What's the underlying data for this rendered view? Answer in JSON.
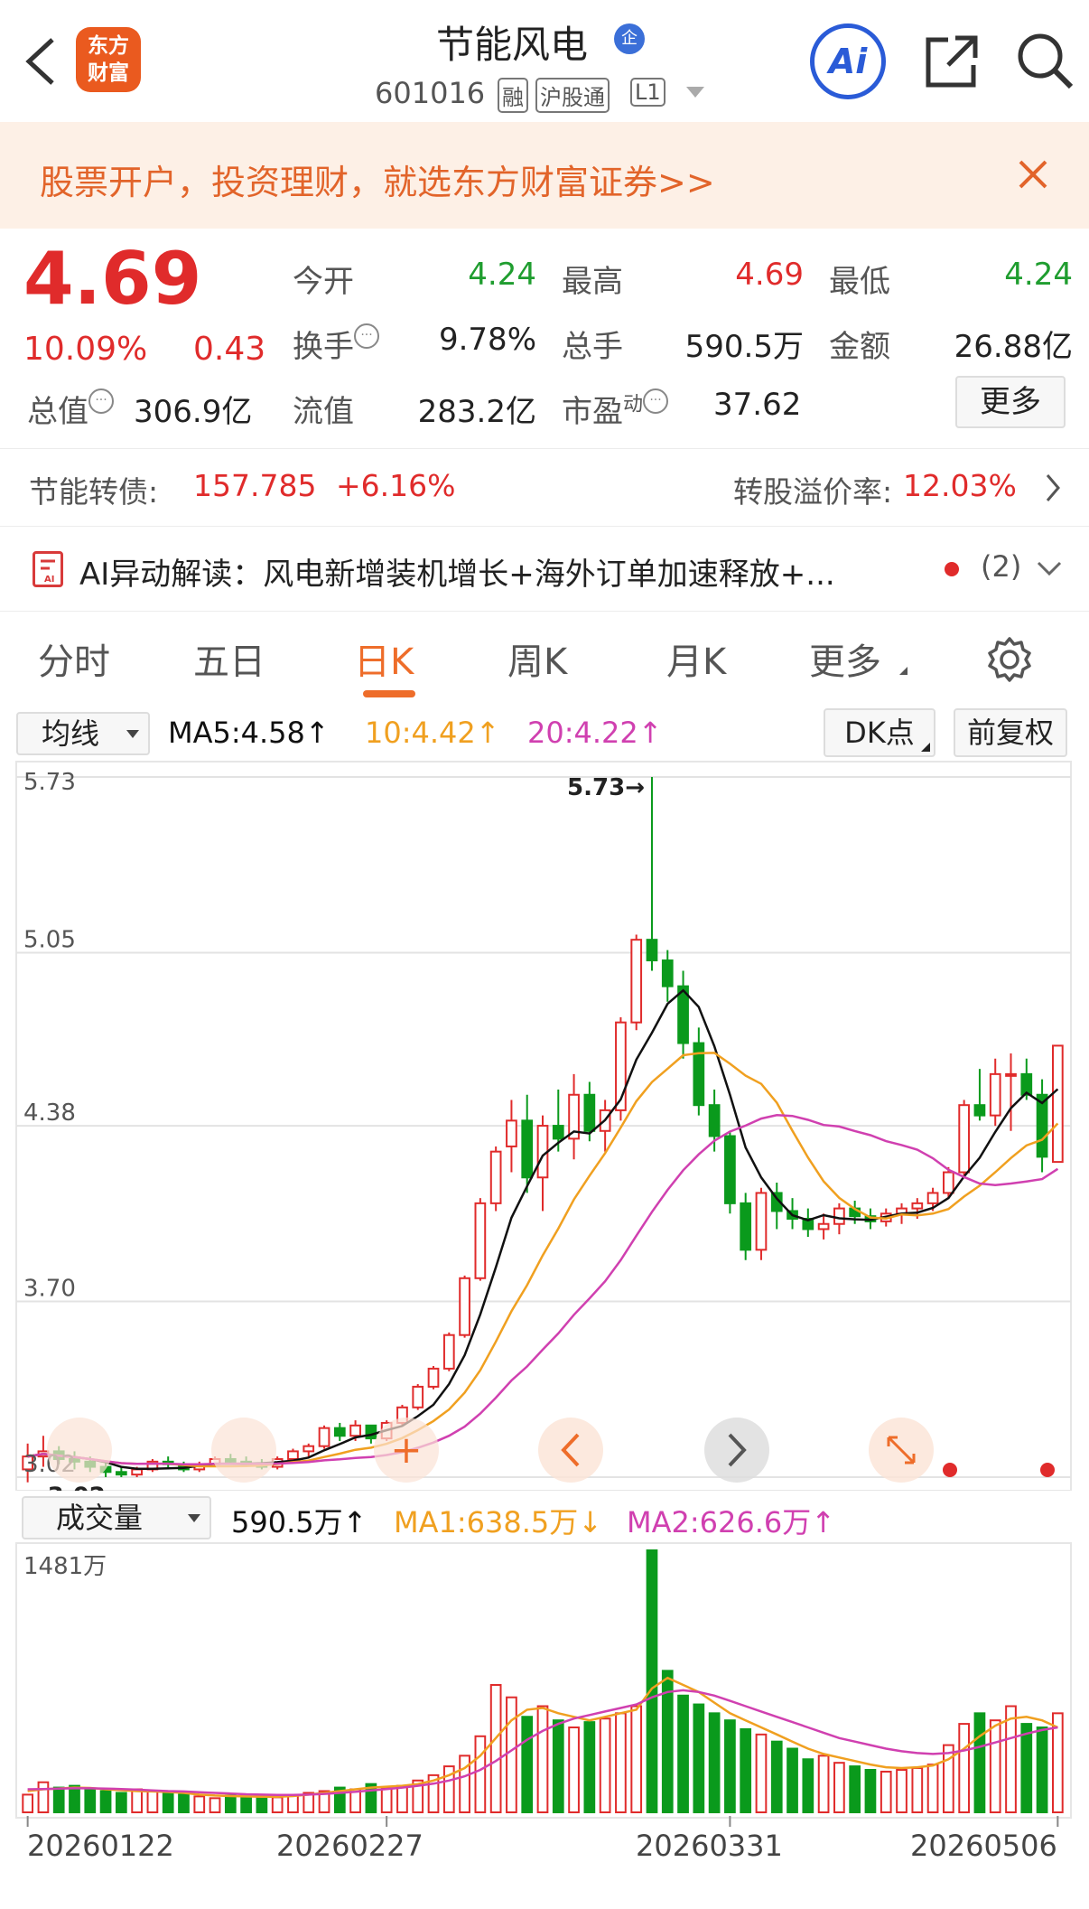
{
  "header": {
    "logo_text": "东方财富",
    "stock_name": "节能风电",
    "badge": "企",
    "code": "601016",
    "tags": [
      "融",
      "沪股通",
      "L1"
    ],
    "ai_label": "Ai"
  },
  "banner": {
    "text": "股票开户，投资理财，就选东方财富证券>>"
  },
  "quote": {
    "price": "4.69",
    "change_pct": "10.09%",
    "change": "0.43",
    "open_label": "今开",
    "open": "4.24",
    "high_label": "最高",
    "high": "4.69",
    "low_label": "最低",
    "low": "4.24",
    "turnover_label": "换手",
    "turnover": "9.78%",
    "volume_label": "总手",
    "volume": "590.5万",
    "amount_label": "金额",
    "amount": "26.88亿",
    "mktcap_label": "总值",
    "mktcap": "306.9亿",
    "float_label": "流值",
    "float_cap": "283.2亿",
    "pe_label": "市盈",
    "pe_sup": "动",
    "pe": "37.62",
    "more_button": "更多"
  },
  "bond": {
    "label": "节能转债:",
    "price": "157.785",
    "change": "+6.16%",
    "premium_label": "转股溢价率:",
    "premium": "12.03%"
  },
  "ai_insight": {
    "text": "AI异动解读：风电新增装机增长+海外订单加速释放+...",
    "count": "(2)"
  },
  "tabs": [
    "分时",
    "五日",
    "日K",
    "周K",
    "月K",
    "更多"
  ],
  "active_tab": "日K",
  "kline_controls": {
    "indicator": "均线",
    "ma5": "MA5:4.58↑",
    "ma10": "10:4.42↑",
    "ma20": "20:4.22↑",
    "dk_button": "DK点",
    "adjust_button": "前复权"
  },
  "volume_controls": {
    "indicator": "成交量",
    "vol": "590.5万↑",
    "ma1": "MA1:638.5万↓",
    "ma2": "MA2:626.6万↑"
  },
  "colors": {
    "up": "#e02b2b",
    "down": "#0a9a1c",
    "ma5": "#111111",
    "ma10": "#f0a020",
    "ma20": "#d040b0",
    "accent": "#ee6d2a"
  },
  "chart_data": [
    {
      "type": "candlestick",
      "y_ticks": [
        "5.73",
        "5.05",
        "4.38",
        "3.70",
        "3.02"
      ],
      "ylim": [
        3.02,
        5.73
      ],
      "max_label": "5.73→",
      "min_label": "3.02",
      "ohlc": [
        [
          3.05,
          3.15,
          3.0,
          3.1
        ],
        [
          3.1,
          3.18,
          3.06,
          3.12
        ],
        [
          3.12,
          3.14,
          3.07,
          3.09
        ],
        [
          3.09,
          3.12,
          3.05,
          3.08
        ],
        [
          3.08,
          3.1,
          3.04,
          3.06
        ],
        [
          3.06,
          3.08,
          3.02,
          3.04
        ],
        [
          3.04,
          3.06,
          3.02,
          3.03
        ],
        [
          3.03,
          3.06,
          3.02,
          3.05
        ],
        [
          3.05,
          3.09,
          3.04,
          3.08
        ],
        [
          3.08,
          3.1,
          3.05,
          3.07
        ],
        [
          3.07,
          3.08,
          3.04,
          3.05
        ],
        [
          3.05,
          3.08,
          3.04,
          3.07
        ],
        [
          3.07,
          3.1,
          3.06,
          3.09
        ],
        [
          3.09,
          3.11,
          3.07,
          3.08
        ],
        [
          3.08,
          3.1,
          3.06,
          3.07
        ],
        [
          3.07,
          3.09,
          3.05,
          3.06
        ],
        [
          3.06,
          3.1,
          3.05,
          3.09
        ],
        [
          3.09,
          3.13,
          3.08,
          3.12
        ],
        [
          3.12,
          3.15,
          3.1,
          3.14
        ],
        [
          3.14,
          3.22,
          3.13,
          3.21
        ],
        [
          3.21,
          3.23,
          3.16,
          3.18
        ],
        [
          3.18,
          3.24,
          3.16,
          3.22
        ],
        [
          3.22,
          3.2,
          3.15,
          3.17
        ],
        [
          3.17,
          3.24,
          3.16,
          3.23
        ],
        [
          3.23,
          3.3,
          3.22,
          3.29
        ],
        [
          3.29,
          3.38,
          3.28,
          3.37
        ],
        [
          3.37,
          3.45,
          3.36,
          3.44
        ],
        [
          3.44,
          3.58,
          3.43,
          3.57
        ],
        [
          3.57,
          3.8,
          3.56,
          3.79
        ],
        [
          3.79,
          4.1,
          3.78,
          4.08
        ],
        [
          4.08,
          4.3,
          4.05,
          4.28
        ],
        [
          4.3,
          4.48,
          4.2,
          4.4
        ],
        [
          4.4,
          4.5,
          4.12,
          4.18
        ],
        [
          4.18,
          4.42,
          4.05,
          4.38
        ],
        [
          4.38,
          4.52,
          4.28,
          4.33
        ],
        [
          4.33,
          4.58,
          4.25,
          4.5
        ],
        [
          4.5,
          4.55,
          4.32,
          4.36
        ],
        [
          4.36,
          4.48,
          4.28,
          4.44
        ],
        [
          4.44,
          4.8,
          4.4,
          4.78
        ],
        [
          4.78,
          5.12,
          4.75,
          5.1
        ],
        [
          5.1,
          5.73,
          4.98,
          5.02
        ],
        [
          5.02,
          5.06,
          4.86,
          4.92
        ],
        [
          4.92,
          4.98,
          4.64,
          4.7
        ],
        [
          4.7,
          4.76,
          4.42,
          4.46
        ],
        [
          4.46,
          4.52,
          4.28,
          4.34
        ],
        [
          4.34,
          4.36,
          4.04,
          4.08
        ],
        [
          4.08,
          4.12,
          3.86,
          3.9
        ],
        [
          3.9,
          4.14,
          3.86,
          4.12
        ],
        [
          4.12,
          4.16,
          3.98,
          4.05
        ],
        [
          4.05,
          4.1,
          3.98,
          4.02
        ],
        [
          4.02,
          4.06,
          3.95,
          3.98
        ],
        [
          3.98,
          4.04,
          3.94,
          4.0
        ],
        [
          4.0,
          4.08,
          3.96,
          4.06
        ],
        [
          4.06,
          4.09,
          4.0,
          4.03
        ],
        [
          4.03,
          4.06,
          3.98,
          4.01
        ],
        [
          4.01,
          4.06,
          3.99,
          4.04
        ],
        [
          4.04,
          4.08,
          4.0,
          4.06
        ],
        [
          4.06,
          4.1,
          4.02,
          4.08
        ],
        [
          4.08,
          4.14,
          4.05,
          4.12
        ],
        [
          4.12,
          4.22,
          4.1,
          4.2
        ],
        [
          4.2,
          4.48,
          4.18,
          4.46
        ],
        [
          4.46,
          4.6,
          4.4,
          4.42
        ],
        [
          4.42,
          4.64,
          4.38,
          4.58
        ],
        [
          4.58,
          4.66,
          4.36,
          4.58
        ],
        [
          4.58,
          4.64,
          4.48,
          4.5
        ],
        [
          4.5,
          4.56,
          4.2,
          4.26
        ],
        [
          4.24,
          4.69,
          4.24,
          4.69
        ]
      ]
    },
    {
      "type": "bar",
      "y_tick": "1481万",
      "ylim": [
        0,
        1481
      ],
      "values": [
        100,
        170,
        140,
        150,
        130,
        120,
        110,
        130,
        120,
        115,
        100,
        90,
        80,
        95,
        90,
        80,
        85,
        95,
        110,
        120,
        140,
        130,
        160,
        140,
        150,
        180,
        210,
        260,
        320,
        430,
        720,
        650,
        540,
        600,
        520,
        480,
        510,
        530,
        560,
        600,
        1481,
        800,
        660,
        610,
        560,
        520,
        470,
        440,
        400,
        360,
        300,
        320,
        280,
        260,
        240,
        230,
        240,
        250,
        270,
        380,
        500,
        560,
        520,
        600,
        500,
        480,
        560
      ],
      "ma1": [
        120,
        130,
        135,
        140,
        138,
        130,
        125,
        120,
        118,
        115,
        110,
        100,
        95,
        92,
        90,
        88,
        88,
        92,
        100,
        110,
        120,
        130,
        140,
        145,
        150,
        160,
        180,
        210,
        250,
        320,
        420,
        520,
        580,
        590,
        560,
        540,
        520,
        540,
        560,
        580,
        700,
        760,
        720,
        680,
        620,
        560,
        520,
        480,
        440,
        400,
        360,
        330,
        310,
        290,
        270,
        255,
        250,
        255,
        265,
        300,
        360,
        430,
        490,
        530,
        540,
        520,
        480
      ],
      "ma2": [
        130,
        132,
        134,
        136,
        136,
        134,
        132,
        128,
        124,
        120,
        118,
        114,
        110,
        106,
        102,
        100,
        98,
        98,
        100,
        104,
        110,
        116,
        124,
        132,
        140,
        150,
        162,
        180,
        204,
        240,
        290,
        350,
        410,
        460,
        500,
        530,
        550,
        570,
        590,
        610,
        650,
        680,
        690,
        680,
        660,
        630,
        600,
        570,
        540,
        510,
        480,
        450,
        420,
        400,
        380,
        360,
        345,
        335,
        330,
        335,
        350,
        370,
        395,
        420,
        445,
        465,
        480
      ]
    }
  ],
  "x_labels": [
    "20260122",
    "20260227",
    "20260331",
    "20260506"
  ]
}
